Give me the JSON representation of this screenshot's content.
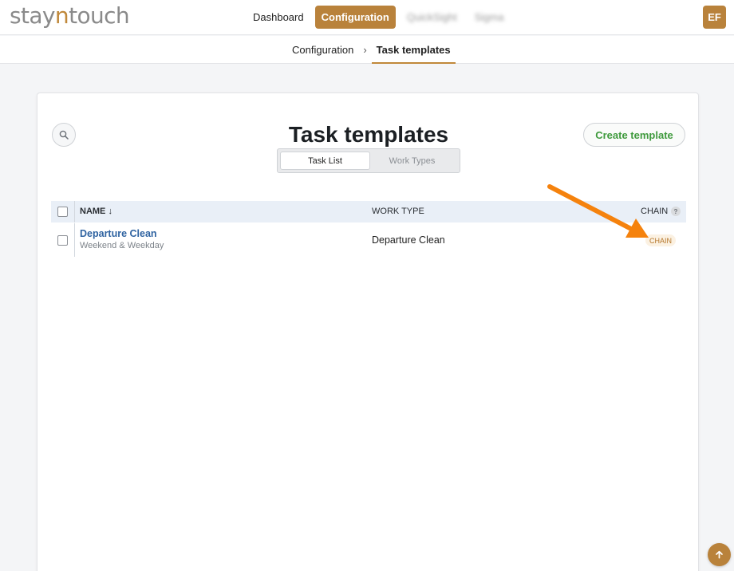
{
  "app": {
    "logo_prefix": "stay",
    "logo_accent": "n",
    "logo_suffix": "touch"
  },
  "nav": {
    "items": [
      {
        "label": "Dashboard",
        "state": "normal"
      },
      {
        "label": "Configuration",
        "state": "active"
      },
      {
        "label": "QuickSight",
        "state": "blurred"
      },
      {
        "label": "Sigma",
        "state": "blurred"
      }
    ],
    "user_initials": "EF"
  },
  "breadcrumb": {
    "parent": "Configuration",
    "separator": "›",
    "current": "Task templates"
  },
  "page": {
    "title": "Task templates",
    "create_button": "Create template",
    "tabs": [
      {
        "label": "Task List",
        "selected": true
      },
      {
        "label": "Work Types",
        "selected": false
      }
    ]
  },
  "table": {
    "headers": {
      "name": "NAME ↓",
      "work_type": "WORK TYPE",
      "chain": "CHAIN",
      "chain_help": "?"
    },
    "rows": [
      {
        "name": "Departure Clean",
        "schedule": "Weekend & Weekday",
        "work_type": "Departure Clean",
        "chain": "CHAIN"
      }
    ]
  },
  "colors": {
    "brand": "#b9823b",
    "link": "#2f63a1",
    "create": "#3f9a3d",
    "annotation_arrow": "#f5820d"
  },
  "icons": {
    "search": "search-icon",
    "scroll_top": "arrow-up-icon"
  }
}
